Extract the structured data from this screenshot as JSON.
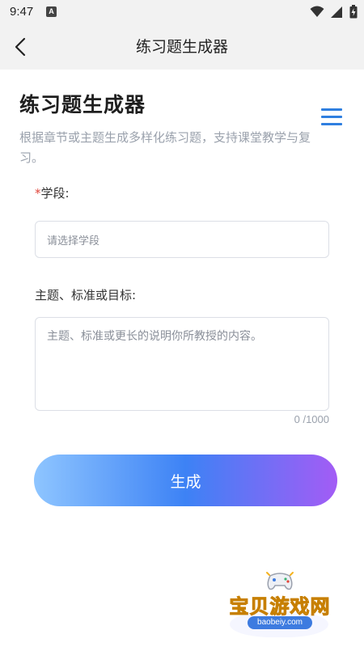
{
  "status_bar": {
    "time": "9:47",
    "app_icon_letter": "A",
    "icons": [
      "notification-app-icon",
      "wifi-icon",
      "signal-icon",
      "battery-icon"
    ]
  },
  "nav_bar": {
    "title": "练习题生成器",
    "back_icon": "chevron-left-icon"
  },
  "page": {
    "title": "练习题生成器",
    "description": "根据章节或主题生成多样化练习题，支持课堂教学与复习。",
    "menu_icon": "hamburger-menu-icon"
  },
  "form": {
    "stage": {
      "required_mark": "*",
      "label": "学段:",
      "placeholder": "请选择学段"
    },
    "topic": {
      "label": "主题、标准或目标:",
      "placeholder": "主题、标准或更长的说明你所教授的内容。",
      "char_count": "0 /1000"
    },
    "submit_label": "生成"
  },
  "watermark": {
    "logo_text": "宝贝游戏网",
    "url": "baobeiy.com"
  },
  "colors": {
    "accent": "#2f7fe0",
    "required": "#e0453a",
    "button_gradient_start": "#8ec5ff",
    "button_gradient_mid": "#3d82f5",
    "button_gradient_end": "#a35cf5"
  }
}
